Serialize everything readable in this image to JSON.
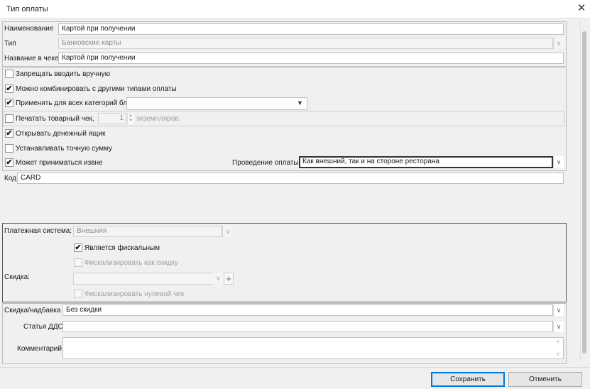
{
  "window": {
    "title": "Тип оплаты",
    "close_glyph": "✕"
  },
  "fields": {
    "name_label": "Наименование",
    "name_value": "Картой при получении",
    "type_label": "Тип",
    "type_value": "Банковские карты",
    "receipt_label": "Название в чеке",
    "receipt_value": "Картой при получении"
  },
  "options": {
    "forbid_manual": {
      "label": "Запрещать вводить вручную",
      "checked": false
    },
    "combine": {
      "label": "Можно комбинировать с другими типами оплаты",
      "checked": true
    },
    "all_categories": {
      "label": "Применять для всех категорий блюд",
      "checked": true,
      "value": ""
    },
    "print_receipt": {
      "label": "Печатать товарный чек,",
      "copies": "1",
      "suffix": "экземпляров.",
      "checked": false
    },
    "open_drawer": {
      "label": "Открывать денежный ящик",
      "checked": true
    },
    "exact_sum": {
      "label": "Устанавливать точную сумму",
      "checked": false
    },
    "external": {
      "label": "Может приниматься извне",
      "checked": true
    },
    "processing_label": "Проведение оплаты:",
    "processing_value": "Как внешний, так и на стороне ресторана"
  },
  "code": {
    "label": "Код",
    "value": "CARD"
  },
  "payment_system": {
    "label": "Платежная система:",
    "value": "Внешняя",
    "fiscal": {
      "label": "Является фискальным",
      "checked": true
    },
    "fiscal_as_discount": {
      "label": "Фискализировать как скидку",
      "checked": false
    },
    "discount_label": "Скидка:",
    "discount_value": "",
    "add_glyph": "+",
    "fiscal_zero": {
      "label": "Фискализировать нулевой чек",
      "checked": false
    }
  },
  "bottom": {
    "discount_label": "Скидка/надбавка",
    "discount_value": "Без скидки",
    "dds_label": "Статья ДДС",
    "dds_value": "",
    "comment_label": "Комментарий",
    "comment_value": ""
  },
  "buttons": {
    "save": "Сохранить",
    "cancel": "Отменить"
  },
  "glyphs": {
    "check": "✔",
    "chevron": "∨",
    "dd_arrow": "▼",
    "up": "▲",
    "down": "▼"
  }
}
